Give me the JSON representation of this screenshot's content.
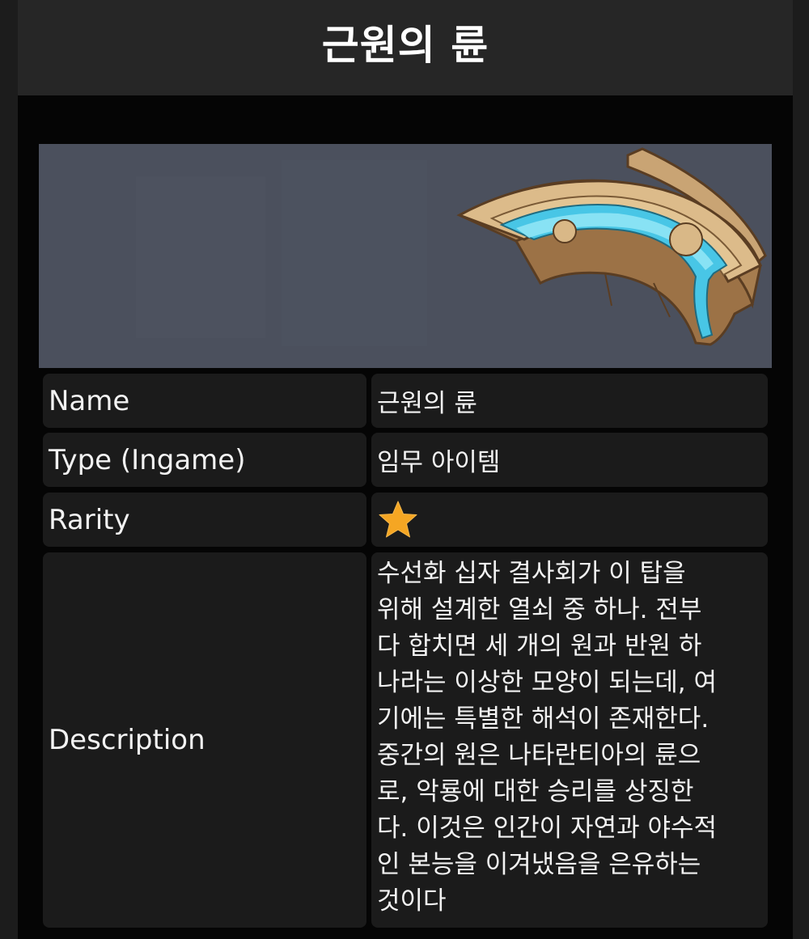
{
  "header": {
    "title": "근원의 륜"
  },
  "item_image": {
    "icon": "ring-fragment-icon",
    "background_color": "#4b505d"
  },
  "rows": {
    "name": {
      "label": "Name",
      "value": "근원의 륜"
    },
    "type": {
      "label": "Type (Ingame)",
      "value": "임무 아이템"
    },
    "rarity": {
      "label": "Rarity",
      "stars": 1,
      "star_color": "#f5a623"
    },
    "description": {
      "label": "Description",
      "value": "수선화 십자 결사회가 이 탑을\n위해 설계한 열쇠 중 하나. 전부\n다 합치면 세 개의 원과 반원 하\n나라는 이상한 모양이 되는데, 여\n기에는 특별한 해석이 존재한다.\n중간의 원은 나타란티아의 륜으\n로, 악룡에 대한 승리를 상징한\n다. 이것은 인간이 자연과 야수적\n인 본능을 이겨냈음을 은유하는\n것이다"
    }
  }
}
